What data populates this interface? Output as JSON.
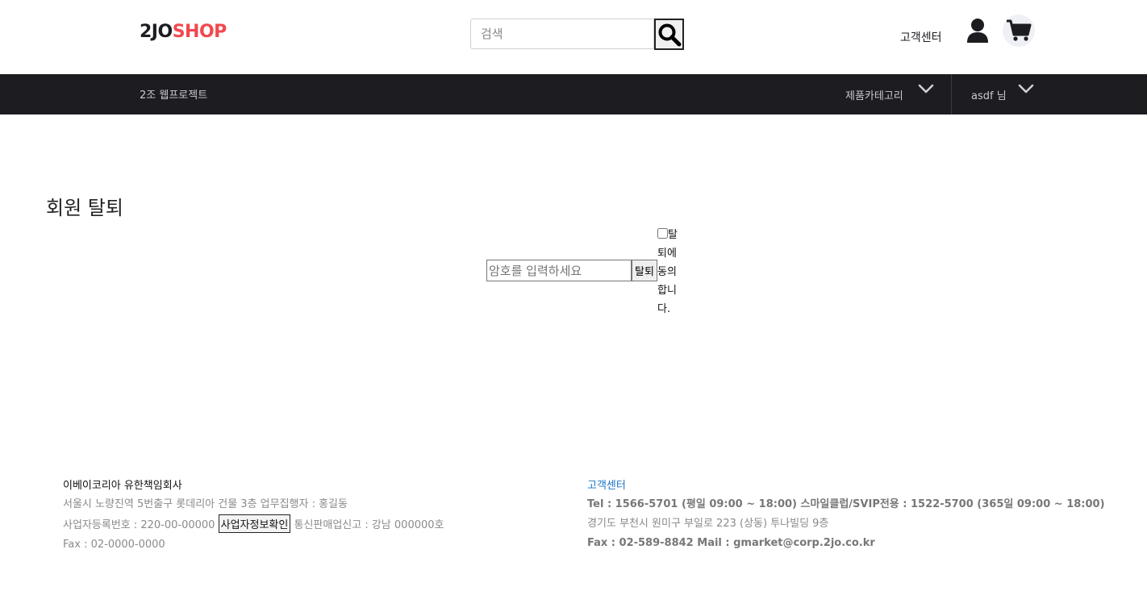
{
  "header": {
    "logo_part1": "2JO",
    "logo_part2": "SHOP",
    "search_placeholder": "검색",
    "search_icon": "magnifier-icon",
    "customer_center": "고객센터",
    "user_icon": "user-icon",
    "cart_icon": "cart-icon"
  },
  "nav": {
    "brand": "2조 웹프로젝트",
    "category": "제품카테고리",
    "user": "asdf 님"
  },
  "main": {
    "title": "회원 탈퇴",
    "password_placeholder": "암호를 입력하세요",
    "withdraw_button": "탈퇴",
    "agree_label": "탈퇴에 동의합니다."
  },
  "footer": {
    "company": "이베이코리아 유한책임회사",
    "address_line": "서울시 노량진역 5번출구 롯데리아 건물 3층    업무집행자 : 홍길동",
    "biz_number": "사업자등록번호 : 220-00-00000",
    "biz_button": "사업자정보확인",
    "mail_order": "통신판매업신고 : 강남 000000호",
    "fax": "Fax : 02-0000-0000",
    "cs_title": "고객센터",
    "tel": "Tel : 1566-5701 (평일 09:00 ~ 18:00)   스마일클럽/SVIP전용 : 1522-5700 (365일 09:00 ~ 18:00)",
    "cs_address": "경기도 부천시 원미구 부일로 223 (상동) 투나빌딩 9층",
    "fax_mail": "Fax : 02-589-8842   Mail : gmarket@corp.2jo.co.kr"
  },
  "colors": {
    "nav_bg": "#1d1d21",
    "logo_accent": "#f0494e",
    "cs_blue": "#1a73c8"
  }
}
